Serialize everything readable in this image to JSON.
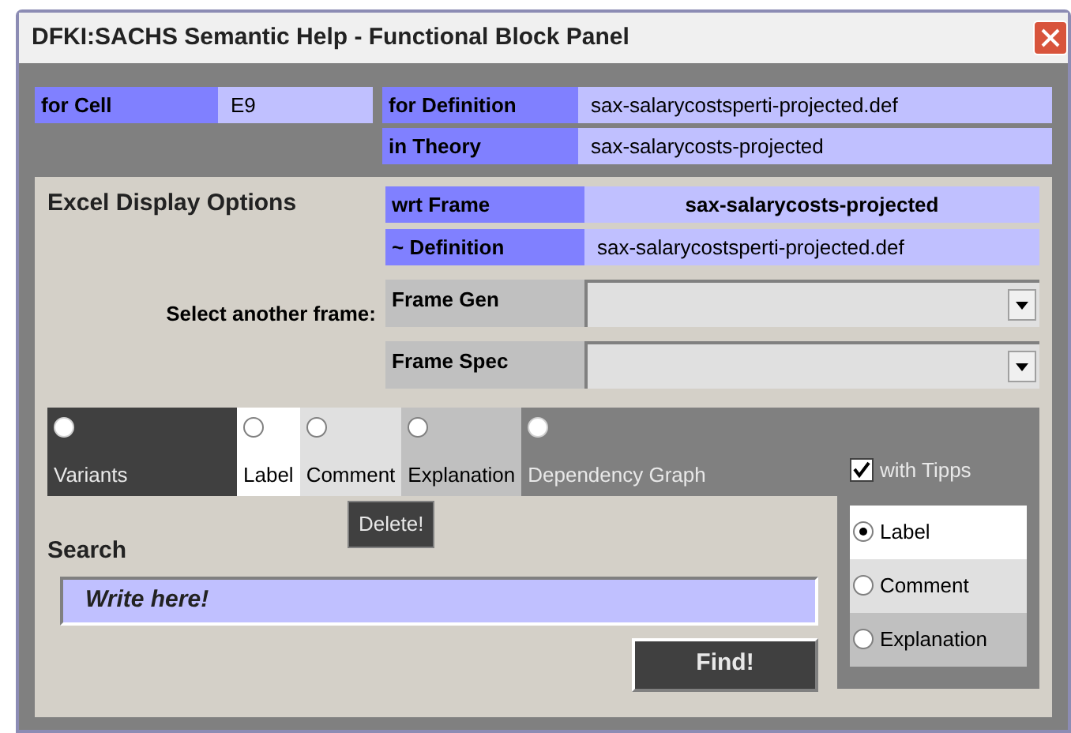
{
  "window": {
    "title": "DFKI:SACHS Semantic Help - Functional Block Panel"
  },
  "cell": {
    "label": "for Cell",
    "value": "E9"
  },
  "definition": {
    "label": "for Definition",
    "value": "sax-salarycostsperti-projected.def"
  },
  "theory": {
    "label": "in Theory",
    "value": "sax-salarycosts-projected"
  },
  "options": {
    "title": "Excel Display Options",
    "wrt_frame": {
      "label": "wrt Frame",
      "value": "sax-salarycosts-projected"
    },
    "similar_definition": {
      "label": "~ Definition",
      "value": "sax-salarycostsperti-projected.def"
    },
    "select_label": "Select another frame:",
    "dropdowns": [
      {
        "label": "Frame Gen"
      },
      {
        "label": "Frame Spec"
      }
    ]
  },
  "tabs": [
    {
      "label": "Variants",
      "selected": false,
      "color": "#404040"
    },
    {
      "label": "Label",
      "selected": false,
      "color": "#ffffff"
    },
    {
      "label": "Comment",
      "selected": false,
      "color": "#e0e0e0"
    },
    {
      "label": "Explanation",
      "selected": false,
      "color": "#c0c0c0"
    },
    {
      "label": "Dependency Graph",
      "selected": false,
      "color": "#808080"
    }
  ],
  "delete_button": "Delete!",
  "search": {
    "label": "Search",
    "value": "Write here!",
    "button": "Find!"
  },
  "with_tipps": {
    "label": "with Tipps",
    "checked": true
  },
  "tipp_options": [
    {
      "label": "Label",
      "selected": true,
      "color": "#ffffff"
    },
    {
      "label": "Comment",
      "selected": false,
      "color": "#e0e0e0"
    },
    {
      "label": "Explanation",
      "selected": false,
      "color": "#c0c0c0"
    }
  ]
}
